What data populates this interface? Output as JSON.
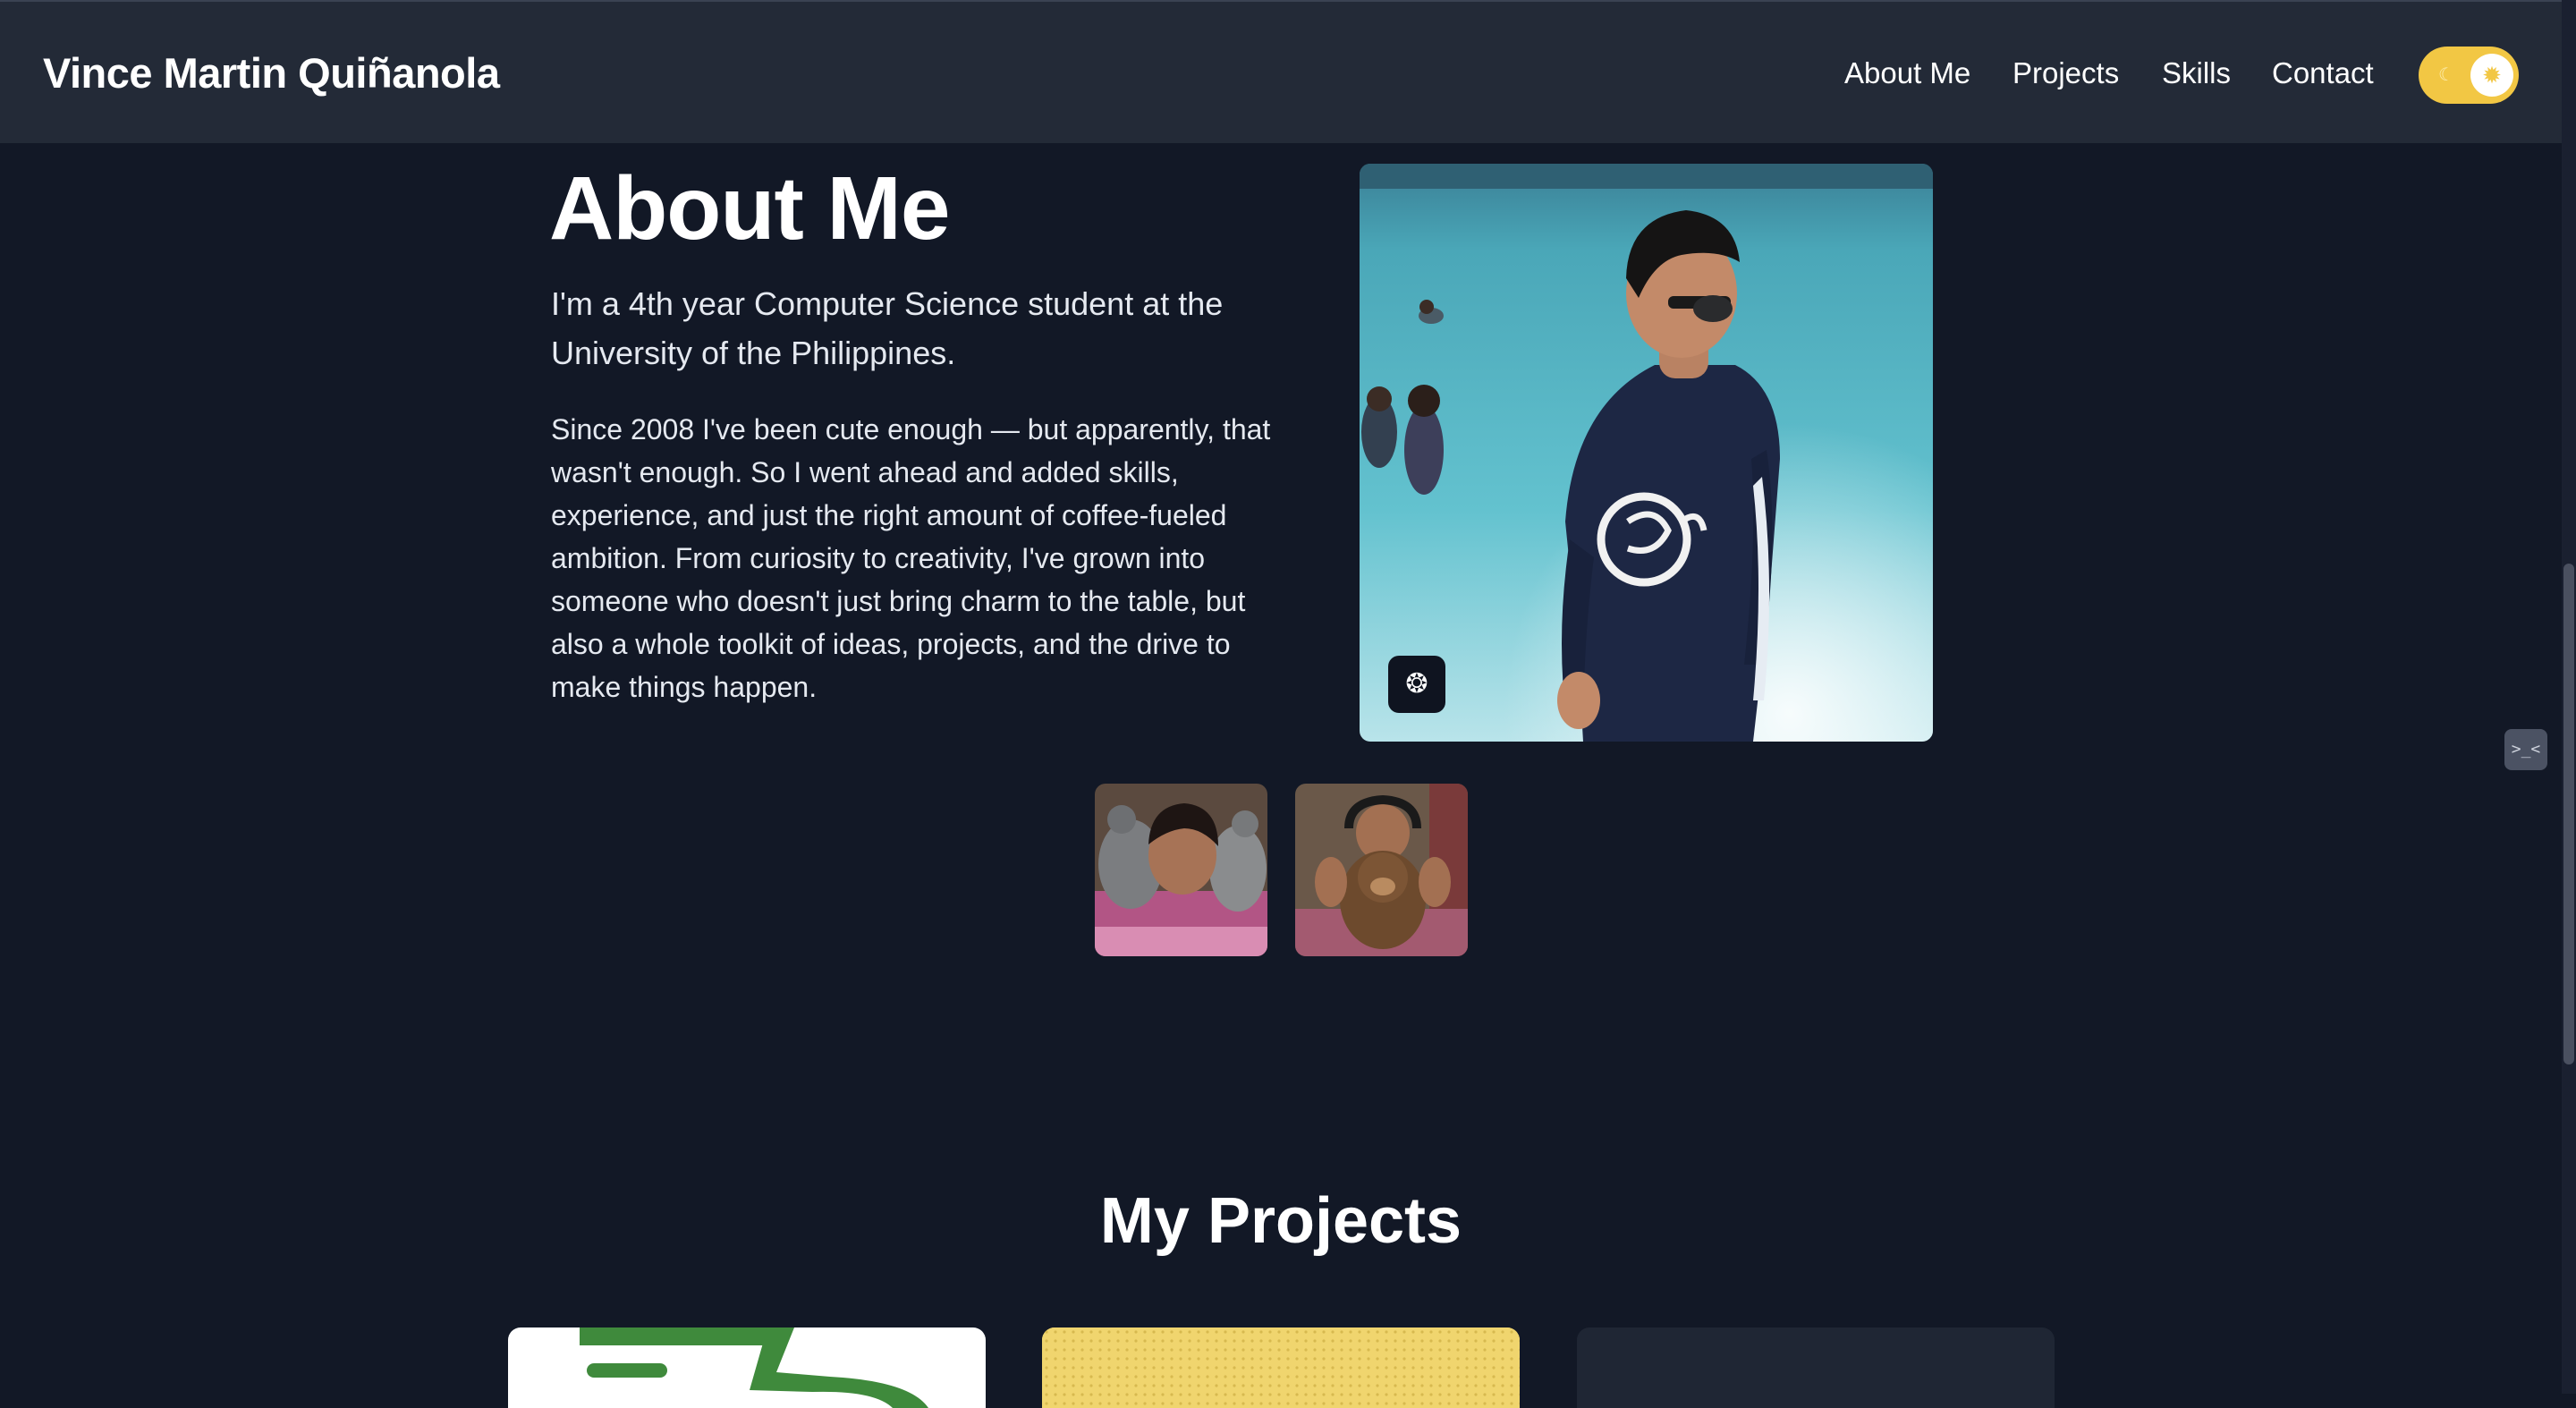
{
  "header": {
    "brand": "Vince Martin Quiñanola",
    "nav": [
      "About Me",
      "Projects",
      "Skills",
      "Contact"
    ],
    "theme_toggle": {
      "state": "light",
      "moon_icon": "☾",
      "sun_icon": "✹",
      "color": "#f2c744"
    }
  },
  "about": {
    "title": "About Me",
    "lead": "I'm a 4th year Computer Science student at the University of the Philippines.",
    "body": "Since 2008 I've been cute enough — but apparently, that wasn't enough. So I went ahead and added skills, experience, and just the right amount of coffee-fueled ambition. From curiosity to creativity, I've grown into someone who doesn't just bring charm to the table, but also a whole toolkit of ideas, projects, and the drive to make things happen.",
    "badge_icon": "brain-icon"
  },
  "side_widget": {
    "icon": "terminal-icon",
    "glyph": ">_<"
  },
  "projects": {
    "title": "My Projects"
  },
  "colors": {
    "background": "#121826",
    "navbar": "#232a37",
    "accent": "#f2c744"
  }
}
